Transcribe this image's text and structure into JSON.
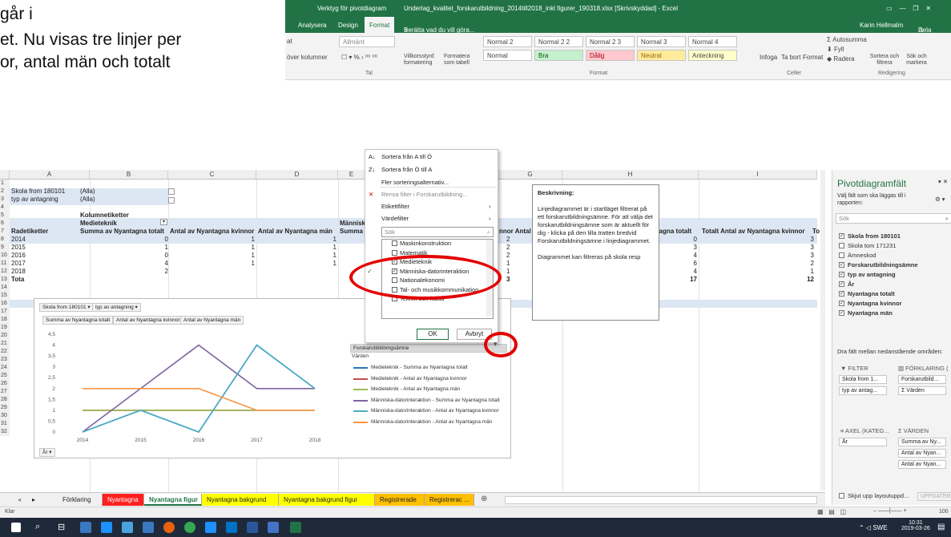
{
  "slide_text": {
    "line1": "går i",
    "line2": "et. Nu visas tre linjer per",
    "line3": "or, antal män och totalt"
  },
  "excel": {
    "context_tab": "Verktyg för pivotdiagram",
    "file_title": "Underlag_kvalitet_forskarutbildning_2014till2018_inkl figurer_190318.xlsx  [Skrivskyddad]  -  Excel",
    "user": "Karin Hellmalm",
    "share": "Dela",
    "tabs": [
      "Analysera",
      "Design",
      "Format"
    ],
    "tell_me": "Berätta vad du vill göra...",
    "ribbon": {
      "number_format": "Allmänt",
      "merge_label": "över kolumner",
      "cond_format": "Villkorsstyrd formatering",
      "format_table": "Formatera som tabell",
      "number_group": "Tal",
      "format_group": "Format",
      "styles": [
        "Normal 2",
        "Normal 2 2",
        "Normal 2 3",
        "Normal 3",
        "Normal 4",
        "Normal",
        "Bra",
        "Dålig",
        "Neutral",
        "Anteckning"
      ],
      "cells_buttons": [
        "Infoga",
        "Ta bort",
        "Format"
      ],
      "cells_group": "Celler",
      "autosum": "Autosumma",
      "fill": "Fyll",
      "clear": "Radera",
      "sort_filter": "Sortera och filtrera",
      "find_select": "Sök och markera",
      "edit_group": "Redigering"
    },
    "columns": [
      "A",
      "B",
      "C",
      "D",
      "E",
      "F",
      "G",
      "H",
      "I"
    ],
    "rows": [
      {
        "n": "1"
      },
      {
        "n": "2",
        "a": "Skola from 180101",
        "b": "(Alla)"
      },
      {
        "n": "3",
        "a": "typ av antagning",
        "b": "(Alla)"
      },
      {
        "n": "4"
      },
      {
        "n": "5",
        "b": "Kolumnetiketter"
      },
      {
        "n": "6",
        "b": "Medieteknik",
        "e": "Människ"
      },
      {
        "n": "7",
        "a": "Radetiketter",
        "b": "Summa av Nyantagna totalt",
        "c": "Antal av Nyantagna kvinnor",
        "d": "Antal av Nyantagna män",
        "e": "Summa a",
        "f": "nnor  Antal",
        "g": "tagna totalt",
        "h": "Totalt Antal av Nyantagna kvinnor",
        "i": "To"
      }
    ],
    "data_rows": [
      {
        "n": "8",
        "year": "2014",
        "b": "0",
        "c": "1",
        "d": "1",
        "f": "2",
        "g": "0",
        "h": "3"
      },
      {
        "n": "9",
        "year": "2015",
        "b": "1",
        "c": "1",
        "d": "1",
        "f": "2",
        "g": "3",
        "h": "3"
      },
      {
        "n": "10",
        "year": "2016",
        "b": "0",
        "c": "1",
        "d": "1",
        "f": "2",
        "g": "4",
        "h": "3"
      },
      {
        "n": "11",
        "year": "2017",
        "b": "4",
        "c": "1",
        "d": "1",
        "f": "1",
        "g": "6",
        "h": "2"
      },
      {
        "n": "12",
        "year": "2018",
        "b": "2",
        "f": "1",
        "fg": "1",
        "g": "4",
        "h": "1"
      }
    ],
    "total_row": {
      "n": "13",
      "label": "Tota",
      "f": "3",
      "fg": "8",
      "g": "17",
      "h": "12"
    },
    "extra_rows": [
      "14",
      "15",
      "16",
      "17",
      "18",
      "19",
      "20",
      "21",
      "22",
      "23",
      "24",
      "25",
      "26",
      "27",
      "28",
      "29",
      "30",
      "31",
      "32"
    ],
    "filter_menu": {
      "sort_asc": "Sortera från A till Ö",
      "sort_desc": "Sortera från Ö till A",
      "more_sort": "Fler sorteringsalternativ...",
      "clear_filter": "Rensa filter i Forskarutbildning...",
      "label_filter": "Etikettfilter",
      "value_filter": "Värdefilter",
      "search_placeholder": "Sök",
      "items": [
        {
          "label": "Maskinkonstruktion",
          "checked": false
        },
        {
          "label": "Matematik",
          "checked": false
        },
        {
          "label": "Medieteknik",
          "checked": true
        },
        {
          "label": "Människa-datorinteraktion",
          "checked": true
        },
        {
          "label": "Nationalekonomi",
          "checked": false
        },
        {
          "label": "Tal- och musikkommunikation",
          "checked": false
        },
        {
          "label": "Teknik och hälsa",
          "checked": false
        }
      ],
      "ok": "OK",
      "cancel": "Avbryt"
    },
    "description": {
      "title": "Beskrivning:",
      "p1": "Linjediagrammet är i startläget filtrerat på ett forskarutbildningsämne. För att välja det forskarutbildningsämne som är aktuellt för dig - klicka på den lilla tratten bredvid Forskarutbildningsämne i linjediagrammet.",
      "p2": "Diagrammet kan filtreras på skola resp"
    },
    "pane": {
      "title": "Pivotdiagramfält",
      "subtitle": "Välj fält som ska läggas till i rapporten:",
      "search": "Sök",
      "fields": [
        {
          "label": "Skola from 180101",
          "checked": true,
          "bold": true
        },
        {
          "label": "Skola tom 171231",
          "checked": false,
          "bold": false
        },
        {
          "label": "Ämneskod",
          "checked": false,
          "bold": false
        },
        {
          "label": "Forskarutbildningsämne",
          "checked": true,
          "bold": true
        },
        {
          "label": "typ av antagning",
          "checked": true,
          "bold": true
        },
        {
          "label": "År",
          "checked": true,
          "bold": true
        },
        {
          "label": "Nyantagna totalt",
          "checked": true,
          "bold": true
        },
        {
          "label": "Nyantagna kvinnor",
          "checked": true,
          "bold": true
        },
        {
          "label": "Nyantagna män",
          "checked": true,
          "bold": true
        }
      ],
      "drag_label": "Dra fält mellan nedanstående områden:",
      "filter_hdr": "FILTER",
      "legend_hdr": "FÖRKLARING (",
      "filter_items": [
        "Skola from 1...",
        "typ av antag..."
      ],
      "legend_items": [
        "Forskarutbild...",
        "Σ Värden"
      ],
      "axis_hdr": "AXEL (KATEG...",
      "values_hdr": "VÄRDEN",
      "axis_items": [
        "År"
      ],
      "value_items": [
        "Summa av Ny...",
        "Antal av Nyan...",
        "Antal av Nyan..."
      ],
      "defer": "Skjut upp layoutuppd...",
      "update": "UPPDATERA"
    },
    "sheet_tabs": [
      {
        "label": "Förklaring",
        "color": "#f0f0f0"
      },
      {
        "label": "Nyantagna",
        "color": "#ff2020"
      },
      {
        "label": "Nyantagna figur",
        "color": "#ffffff"
      },
      {
        "label": "Nyantagna bakgrund",
        "color": "#ffff00"
      },
      {
        "label": "Nyantagna bakgrund figur",
        "color": "#ffff00"
      },
      {
        "label": "Registrerade",
        "color": "#ffc000"
      },
      {
        "label": "Registrerac ...",
        "color": "#ffc000"
      }
    ],
    "status_ready": "Klar",
    "zoom": "100"
  },
  "chart_data": {
    "type": "line",
    "filter_buttons": [
      "Skola from 180101",
      "typ av antagning"
    ],
    "value_buttons": [
      "Summa av Nyantagna totalt",
      "Antal av Nyantagna kvinnor",
      "Antal av Nyantagna män"
    ],
    "legend_field": "Forskarutbildningsämne",
    "legend_sub": "Värden",
    "axis_button": "År",
    "categories": [
      "2014",
      "2015",
      "2016",
      "2017",
      "2018"
    ],
    "ylim": [
      0,
      4.5
    ],
    "yticks": [
      "0",
      "0,5",
      "1",
      "1,5",
      "2",
      "2,5",
      "3",
      "3,5",
      "4",
      "4,5"
    ],
    "series": [
      {
        "name": "Medieteknik - Summa av Nyantagna totalt",
        "color": "#2e75b6",
        "values": [
          0,
          1,
          0,
          4,
          2
        ]
      },
      {
        "name": "Medieteknik - Antal av Nyantagna kvinnor",
        "color": "#c0504d",
        "values": [
          1,
          1,
          1,
          1,
          null
        ]
      },
      {
        "name": "Medieteknik - Antal av Nyantagna män",
        "color": "#9bbb59",
        "values": [
          1,
          1,
          1,
          1,
          1
        ]
      },
      {
        "name": "Människa-datorinteraktion - Summa av Nyantagna totalt",
        "color": "#8064a2",
        "values": [
          0,
          2,
          4,
          2,
          2
        ]
      },
      {
        "name": "Människa-datorinteraktion - Antal av Nyantagna kvinnor",
        "color": "#4bacc6",
        "values": [
          0,
          1,
          0,
          4,
          2
        ]
      },
      {
        "name": "Människa-datorinteraktion - Antal av Nyantagna män",
        "color": "#f79646",
        "values": [
          2,
          2,
          2,
          1,
          1
        ]
      }
    ]
  },
  "taskbar": {
    "lang": "SWE",
    "time": "10:31",
    "date": "2019-03-26"
  }
}
